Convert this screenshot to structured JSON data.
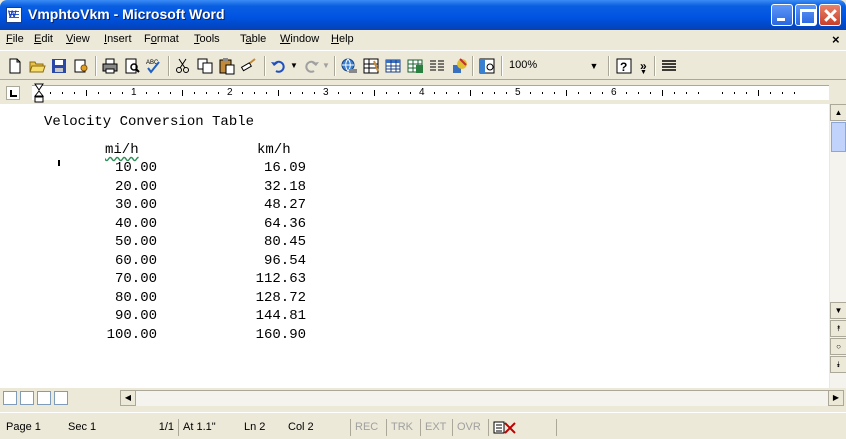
{
  "window": {
    "title": "VmphtoVkm - Microsoft Word"
  },
  "menu": [
    "File",
    "Edit",
    "View",
    "Insert",
    "Format",
    "Tools",
    "Table",
    "Window",
    "Help"
  ],
  "menu_underline": [
    "F",
    "E",
    "V",
    "I",
    "o",
    "T",
    "a",
    "W",
    "H"
  ],
  "toolbar": {
    "zoom": "100%"
  },
  "ruler": {
    "numbers": [
      "1",
      "2",
      "3",
      "4",
      "5",
      "6"
    ]
  },
  "document": {
    "title": "Velocity Conversion Table",
    "col1_header": "mi/h",
    "col2_header": "km/h",
    "rows": [
      [
        "10.00",
        "16.09"
      ],
      [
        "20.00",
        "32.18"
      ],
      [
        "30.00",
        "48.27"
      ],
      [
        "40.00",
        "64.36"
      ],
      [
        "50.00",
        "80.45"
      ],
      [
        "60.00",
        "96.54"
      ],
      [
        "70.00",
        "112.63"
      ],
      [
        "80.00",
        "128.72"
      ],
      [
        "90.00",
        "144.81"
      ],
      [
        "100.00",
        "160.90"
      ]
    ]
  },
  "status": {
    "page": "Page 1",
    "sec": "Sec 1",
    "pages": "1/1",
    "at": "At 1.1\"",
    "ln": "Ln 2",
    "col": "Col 2",
    "rec": "REC",
    "trk": "TRK",
    "ext": "EXT",
    "ovr": "OVR"
  }
}
